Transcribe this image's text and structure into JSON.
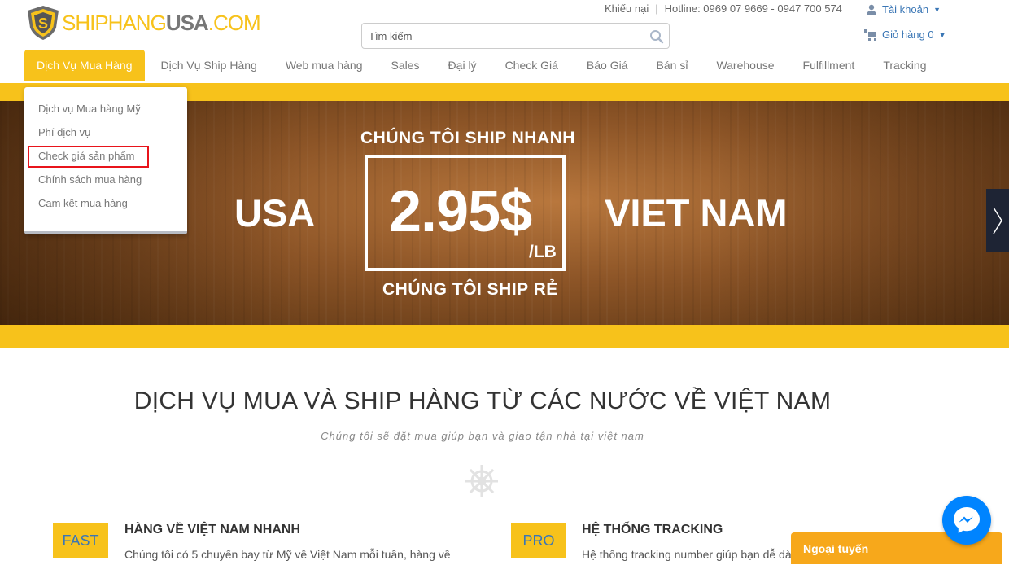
{
  "header": {
    "logo": {
      "part1": "SHIPHANG",
      "part2": "USA",
      "part3": ".COM"
    },
    "complaint": "Khiếu nại",
    "separator": "|",
    "hotline": "Hotline:  0969 07 9669 - 0947 700 574",
    "account_label": "Tài khoản",
    "cart_label": "Giỏ hàng 0",
    "search_placeholder": "Tìm kiếm"
  },
  "nav": {
    "items": [
      {
        "label": "Dịch Vụ Mua Hàng"
      },
      {
        "label": "Dịch Vụ Ship Hàng"
      },
      {
        "label": "Web mua hàng"
      },
      {
        "label": "Sales"
      },
      {
        "label": "Đại lý"
      },
      {
        "label": "Check Giá"
      },
      {
        "label": "Báo Giá"
      },
      {
        "label": "Bán sỉ"
      },
      {
        "label": "Warehouse"
      },
      {
        "label": "Fulfillment"
      },
      {
        "label": "Tracking"
      }
    ],
    "dropdown": [
      {
        "label": "Dịch vụ Mua hàng Mỹ"
      },
      {
        "label": "Phí dịch vụ"
      },
      {
        "label": "Check giá sản phẩm"
      },
      {
        "label": "Chính sách mua hàng"
      },
      {
        "label": "Cam kết mua hàng"
      }
    ]
  },
  "banner": {
    "top": "CHÚNG TÔI SHIP NHANH",
    "left": "USA",
    "price": "2.95$",
    "unit": "/LB",
    "right": "VIET NAM",
    "bottom": "CHÚNG TÔI SHIP RẺ"
  },
  "section": {
    "title": "DỊCH VỤ MUA VÀ SHIP HÀNG TỪ CÁC NƯỚC VỀ VIỆT NAM",
    "subtitle": "Chúng tôi sẽ đặt mua giúp bạn và giao tận nhà tại việt nam",
    "features": [
      {
        "tag": "FAST",
        "title": "HÀNG VỀ VIỆT NAM NHANH",
        "desc": "Chúng tôi có 5 chuyến bay từ Mỹ về Việt Nam mỗi tuần, hàng về"
      },
      {
        "tag": "PRO",
        "title": "HỆ THỐNG TRACKING",
        "desc": "Hệ thống tracking number giúp bạn dễ dà"
      }
    ]
  },
  "chat": {
    "offline_label": "Ngoại tuyến"
  },
  "colors": {
    "brand_yellow": "#f7c21b",
    "link_blue": "#3a76b5",
    "highlight_red": "#e8141b",
    "messenger_blue": "#0084ff"
  }
}
